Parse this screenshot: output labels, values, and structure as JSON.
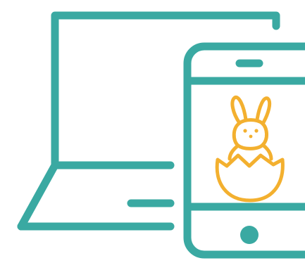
{
  "illustration": {
    "icons": [
      "laptop-icon",
      "smartphone-icon",
      "easter-bunny-in-egg-icon"
    ],
    "colors": {
      "device_stroke": "#3aa9a2",
      "bunny_stroke": "#f3b02f",
      "background": "#ffffff"
    }
  }
}
